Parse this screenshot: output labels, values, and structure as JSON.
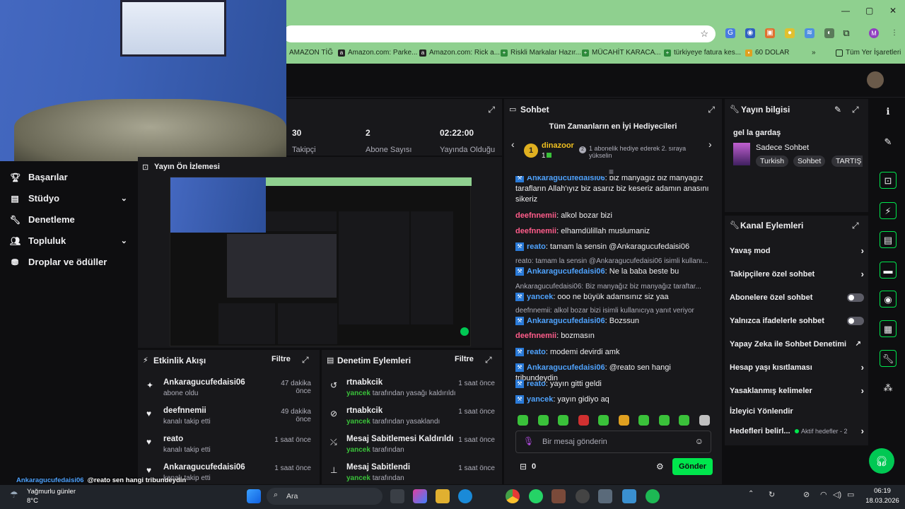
{
  "browser": {
    "bookmarks": [
      "AMAZON TİĞ",
      "Amazon.com: Parke...",
      "Amazon.com: Rick a...",
      "Riskli Markalar Hazır...",
      "MÜCAHİT KARACA...",
      "türkiyeye fatura kes...",
      "60 DOLAR",
      "Tüm Yer İşaretleri"
    ],
    "profile_initial": "M"
  },
  "leftnav": {
    "items": [
      {
        "label": "Başarılar",
        "icon": "trophy-icon"
      },
      {
        "label": "Stüdyo",
        "icon": "studio-icon"
      },
      {
        "label": "Denetleme",
        "icon": "wrench-icon"
      },
      {
        "label": "Topluluk",
        "icon": "community-icon"
      },
      {
        "label": "Droplar ve ödüller",
        "icon": "drops-icon"
      }
    ]
  },
  "stats": [
    {
      "value": "30",
      "label": "Takipçi"
    },
    {
      "value": "2",
      "label": "Abone Sayısı"
    },
    {
      "value": "02:22:00",
      "label": "Yayında Olduğu"
    }
  ],
  "preview": {
    "title": "Yayın Ön İzlemesi"
  },
  "activity": {
    "title": "Etkinlik Akışı",
    "filter": "Filtre",
    "items": [
      {
        "name": "Ankaragucufedaisi06",
        "sub": "abone oldu",
        "time": "47 dakika önce",
        "icon": "sparkle-icon"
      },
      {
        "name": "deefnnemii",
        "sub": "kanalı takip etti",
        "time": "49 dakika önce",
        "icon": "heart-icon"
      },
      {
        "name": "reato",
        "sub": "kanalı takip etti",
        "time": "1 saat önce",
        "icon": "heart-icon"
      },
      {
        "name": "Ankaragucufedaisi06",
        "sub": "kanalı takip etti",
        "time": "1 saat önce",
        "icon": "heart-icon"
      }
    ]
  },
  "moderation": {
    "title": "Denetim Eylemleri",
    "filter": "Filtre",
    "items": [
      {
        "name": "rtnabkcik",
        "user": "yancek",
        "sub": "tarafından yasağı kaldırıldı",
        "time": "1 saat önce",
        "icon": "undo-icon"
      },
      {
        "name": "rtnabkcik",
        "user": "yancek",
        "sub": "tarafından yasaklandı",
        "time": "1 saat önce",
        "icon": "ban-icon"
      },
      {
        "name": "Mesaj Sabitlemesi Kaldırıldı",
        "user": "yancek",
        "sub": "tarafından",
        "time": "1 saat önce",
        "icon": "unpin-icon"
      },
      {
        "name": "Mesaj Sabitlendi",
        "user": "yancek",
        "sub": "tarafından",
        "time": "1 saat önce",
        "icon": "pin-icon"
      }
    ]
  },
  "chat": {
    "title": "Sohbet",
    "leaderboard_title": "Tüm Zamanların en İyi Hediyecileri",
    "top_gifter": "dinazoor",
    "top_gifter_count": "1",
    "rank": "1",
    "hint": "1 abonelik hediye ederek 2. sıraya yükselin",
    "messages": [
      {
        "user": "Ankaragucufedaisi06",
        "color": "blue",
        "text": ": biz manyağız biz manyağız tarafların Allah'ıyız biz asarız biz keseriz adamın anasını sikeriz"
      },
      {
        "user": "deefnnemii",
        "color": "red",
        "text": ": alkol bozar bizi"
      },
      {
        "user": "deefnnemii",
        "color": "red",
        "text": ": elhamdülillah muslumaniz"
      },
      {
        "user": "reato",
        "color": "blue",
        "text": ": tamam la sensin @Ankaragucufedaisi06"
      },
      {
        "reply": "reato: tamam la sensin @Ankaragucufedaisi06 isimli kullanı...",
        "user": "Ankaragucufedaisi06",
        "color": "blue",
        "text": ": Ne la baba beste bu"
      },
      {
        "reply": "Ankaragucufedaisi06: Biz manyağız biz manyağız taraftar...",
        "user": "yancek",
        "color": "blue",
        "text": ": ooo ne büyük adamsınız siz yaa"
      },
      {
        "reply": "deefnnemii: alkol bozar bizi isimli kullanıcıya yanıt veriyor",
        "user": "Ankaragucufedaisi06",
        "color": "blue",
        "text": ": Bozssun"
      },
      {
        "user": "deefnnemii",
        "color": "red",
        "text": ": bozmasın"
      },
      {
        "user": "reato",
        "color": "blue",
        "text": ": modemi devirdi amk"
      },
      {
        "user": "Ankaragucufedaisi06",
        "color": "blue",
        "text": ": @reato sen hangi tribundeydin"
      },
      {
        "user": "reato",
        "color": "blue",
        "text": ": yayın gitti geldi"
      },
      {
        "user": "yancek",
        "color": "blue",
        "text": ": yayın gidiyo aq"
      }
    ],
    "input_placeholder": "Bir mesaj gönderin",
    "points": "0",
    "send_label": "Gönder"
  },
  "stream_info": {
    "title": "Yayın bilgisi",
    "stream_title": "gel la gardaş",
    "category": "Sadece Sohbet",
    "tags": [
      "Turkish",
      "Sohbet",
      "TARTIŞ"
    ]
  },
  "channel_actions": {
    "title": "Kanal Eylemleri",
    "items": [
      {
        "label": "Yavaş mod",
        "kind": "chevron"
      },
      {
        "label": "Takipçilere özel sohbet",
        "kind": "chevron"
      },
      {
        "label": "Abonelere özel sohbet",
        "kind": "toggle"
      },
      {
        "label": "Yalnızca ifadelerle sohbet",
        "kind": "toggle"
      },
      {
        "label": "Yapay Zeka ile Sohbet Denetimi",
        "kind": "external"
      },
      {
        "label": "Hesap yaşı kısıtlaması",
        "kind": "chevron"
      },
      {
        "label": "Yasaklanmış kelimeler",
        "kind": "chevron"
      },
      {
        "label": "İzleyici Yönlendir",
        "kind": "none"
      },
      {
        "label": "Hedefleri belirl...",
        "kind": "chevron",
        "extra": "Aktif hedefler - 2"
      }
    ]
  },
  "overlay_chat": [
    {
      "user": "Ankaragucufedaisi06",
      "text": "@reato sen hangi tribundeydin"
    },
    {
      "user": "reato",
      "text": "yayın gitti geldi"
    },
    {
      "user": "yancek",
      "text": "yayın gidiyo aq"
    }
  ],
  "taskbar": {
    "weather": "Yağmurlu günler",
    "temp": "8°C",
    "search": "Ara",
    "time": "06:19",
    "date": "18.03.2026"
  },
  "colors": {
    "accent_green": "#00e64d",
    "panel": "#18181b",
    "bg": "#0e0e10",
    "chrome": "#8fd08f"
  }
}
